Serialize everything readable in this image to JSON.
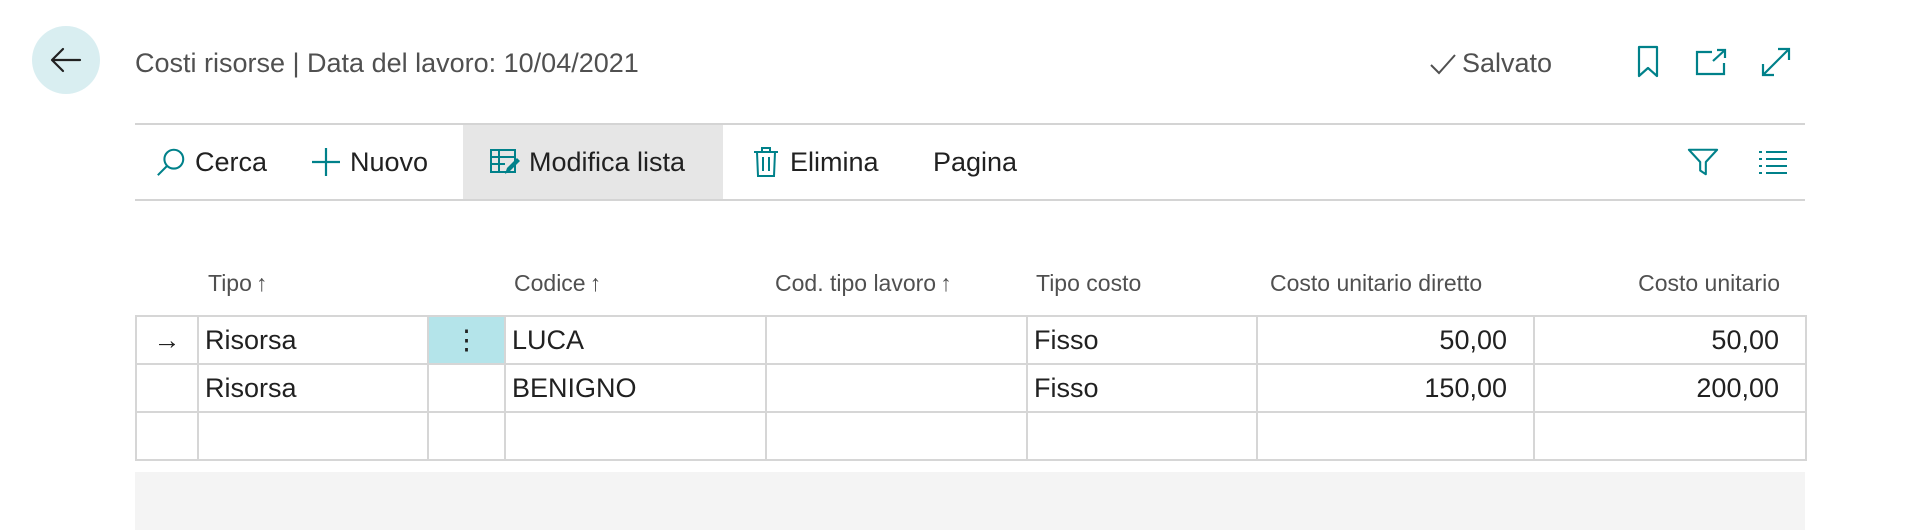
{
  "header": {
    "title": "Costi risorse | Data del lavoro: 10/04/2021",
    "saved_label": "Salvato",
    "icons": [
      "back-arrow-icon",
      "bookmark-icon",
      "open-new-window-icon",
      "expand-icon"
    ]
  },
  "actions": {
    "search": "Cerca",
    "new": "Nuovo",
    "edit_list": "Modifica lista",
    "delete": "Elimina",
    "page": "Pagina"
  },
  "columns": {
    "tipo": "Tipo",
    "codice": "Codice",
    "cod_tipo_lavoro": "Cod. tipo lavoro",
    "tipo_costo": "Tipo costo",
    "costo_unitario_diretto": "Costo unitario diretto",
    "costo_unitario": "Costo unitario",
    "sort_icon": "↑"
  },
  "rows": [
    {
      "tipo": "Risorsa",
      "codice": "LUCA",
      "cod_tipo_lavoro": "",
      "tipo_costo": "Fisso",
      "costo_unitario_diretto": "50,00",
      "costo_unitario": "50,00"
    },
    {
      "tipo": "Risorsa",
      "codice": "BENIGNO",
      "cod_tipo_lavoro": "",
      "tipo_costo": "Fisso",
      "costo_unitario_diretto": "150,00",
      "costo_unitario": "200,00"
    },
    {
      "tipo": "",
      "codice": "",
      "cod_tipo_lavoro": "",
      "tipo_costo": "",
      "costo_unitario_diretto": "",
      "costo_unitario": ""
    }
  ],
  "row_indicator": "→",
  "row_menu": "⋮",
  "colors": {
    "accent": "#00818a",
    "back_bg": "#d9eef1",
    "selected_cell": "#b4e4ea"
  }
}
